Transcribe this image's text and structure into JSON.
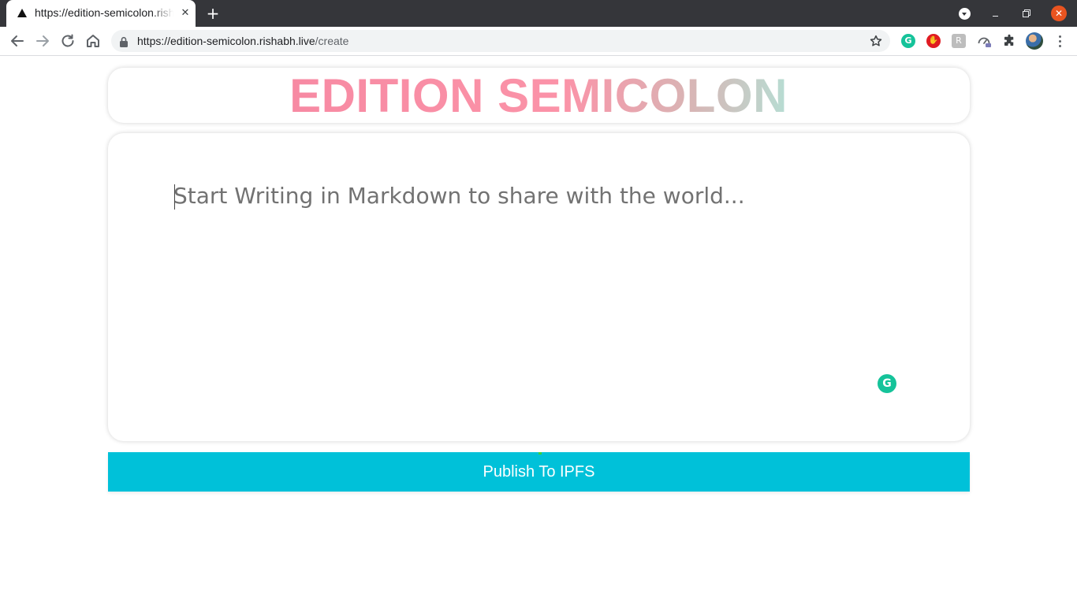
{
  "browser": {
    "tab": {
      "title": "https://edition-semicolon.rishabh.live/create",
      "close": "✕",
      "favicon": "triangle-icon"
    },
    "new_tab": "+",
    "window": {
      "close": "✕"
    },
    "url": {
      "host": "https://edition-semicolon.rishabh.live",
      "path": "/create"
    },
    "extensions": {
      "grammarly": "G",
      "block": "✋",
      "rss": "R"
    }
  },
  "page": {
    "title": "EDITION SEMICOLON",
    "title_gradient": [
      "#f78aa3",
      "#fb93a8",
      "#d9b4b4",
      "#b7ddd3"
    ],
    "editor": {
      "placeholder": "Start Writing in Markdown to share with the world...",
      "value": ""
    },
    "grammarly_badge": "G",
    "publish_label": "Publish To IPFS",
    "publish_color": "#00c1d9"
  }
}
